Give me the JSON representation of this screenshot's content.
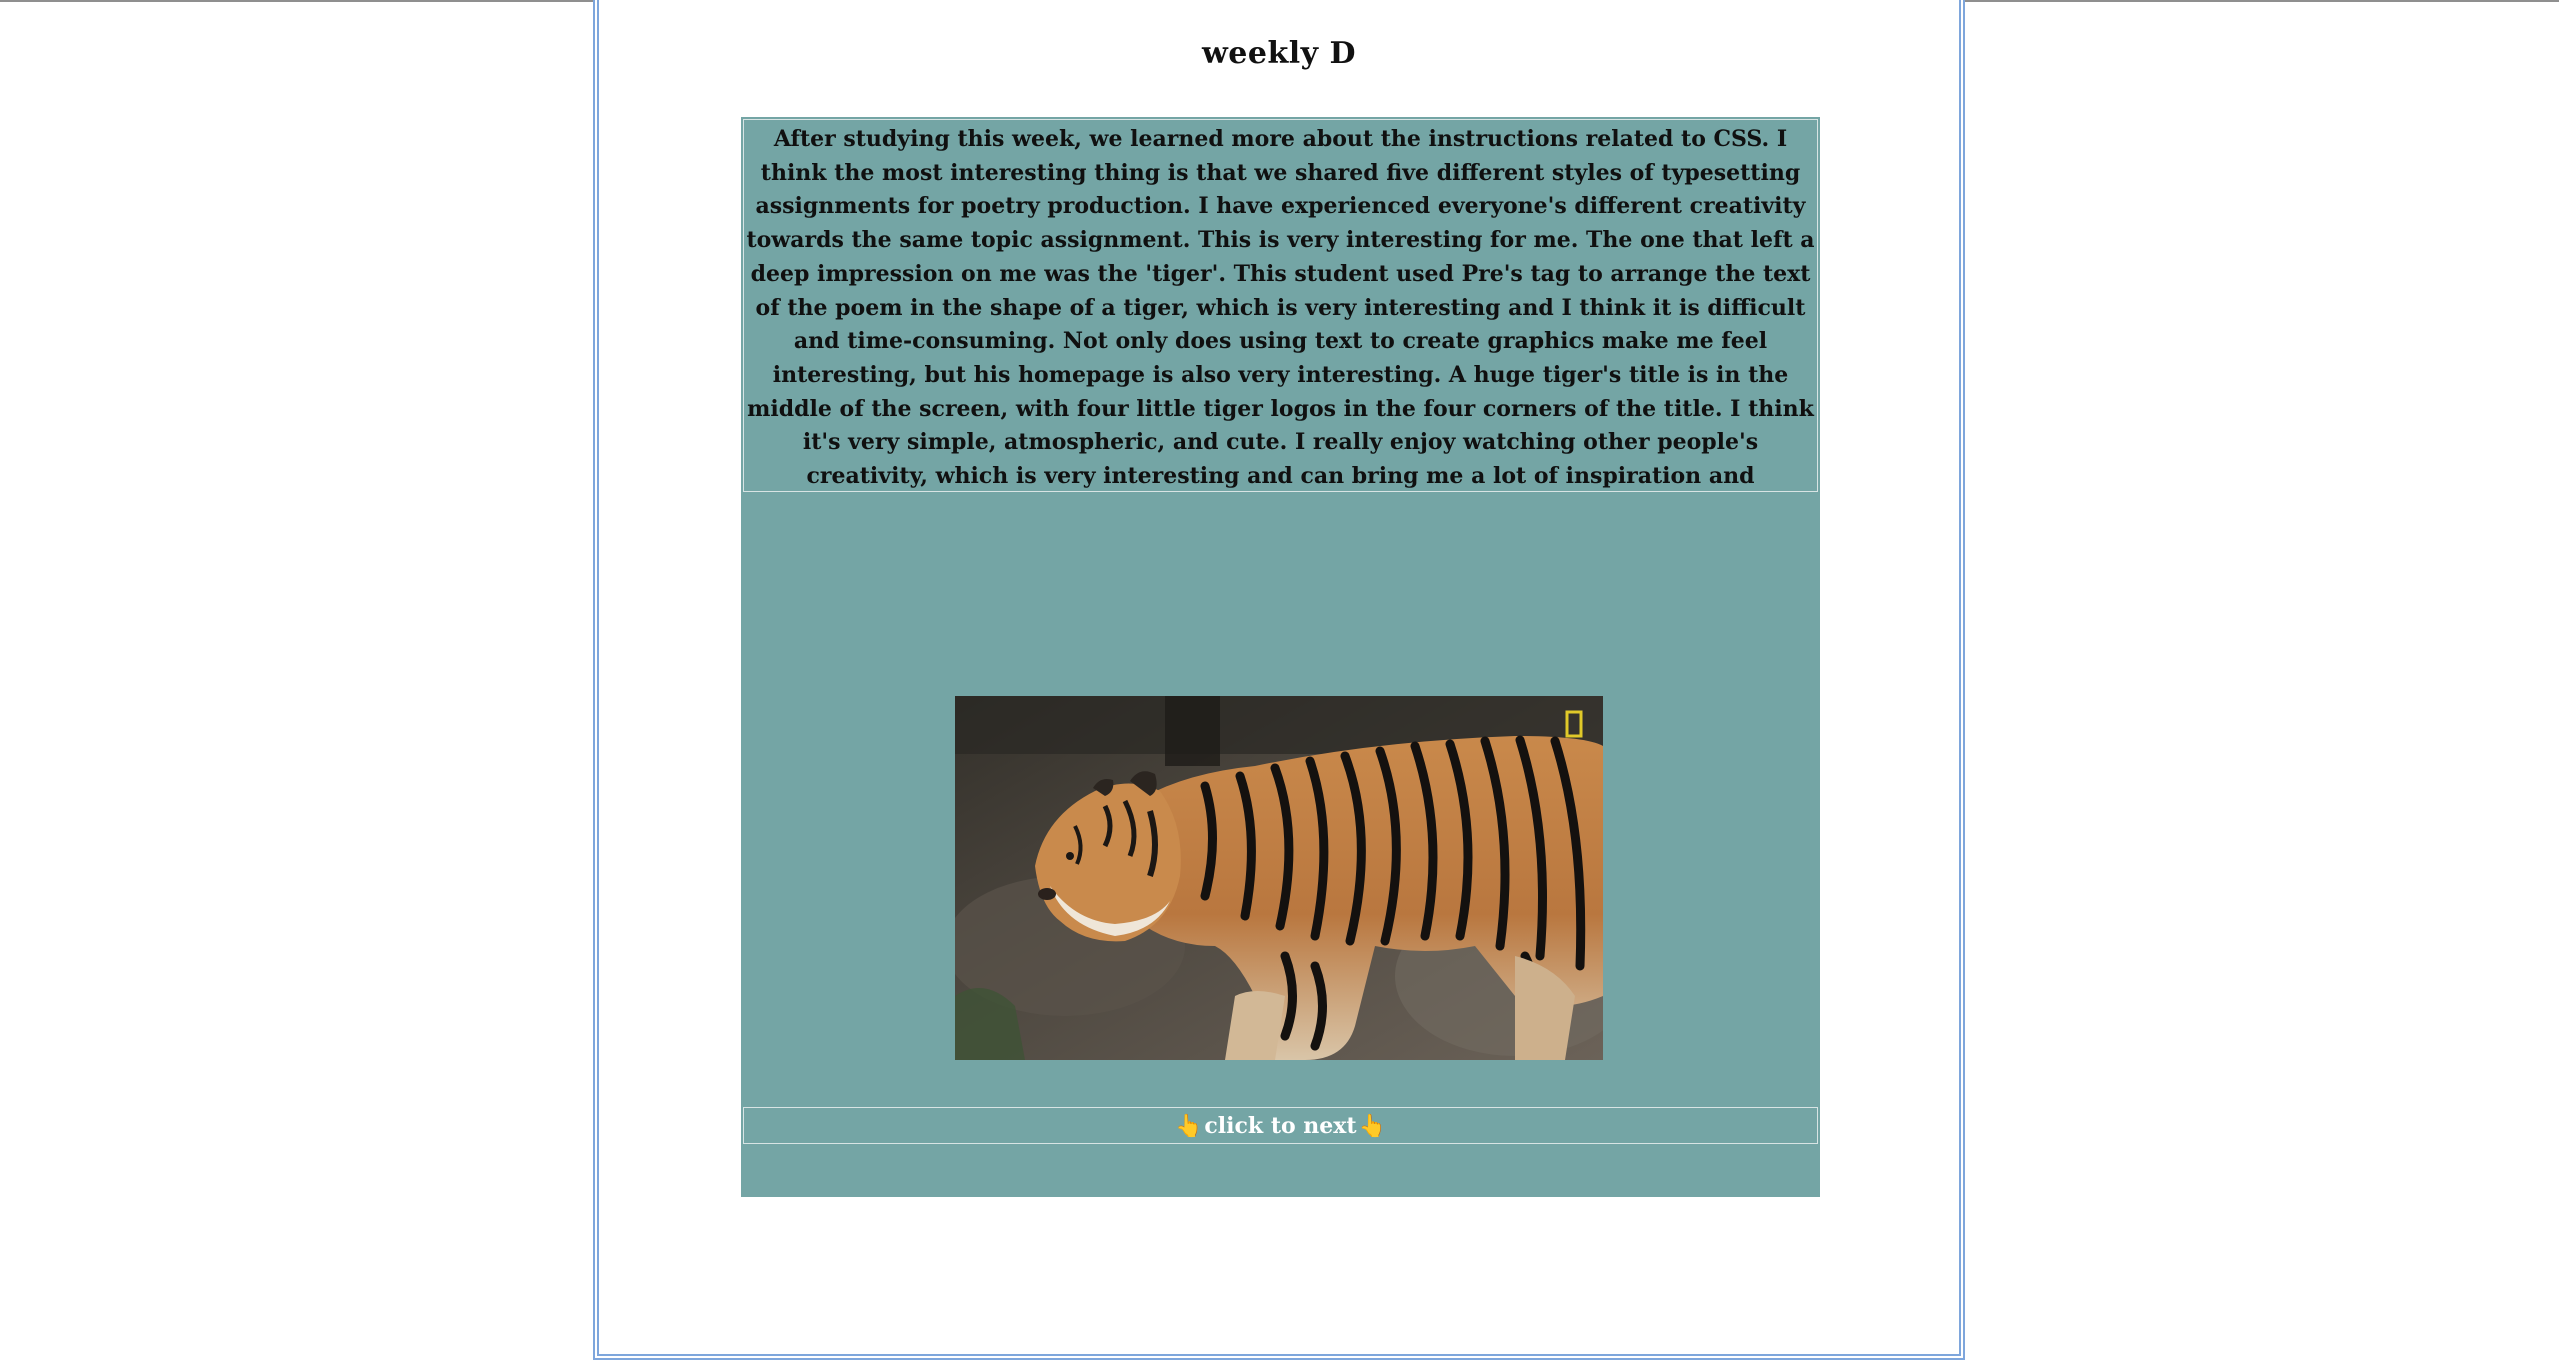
{
  "page": {
    "title": "weekly D"
  },
  "essay": {
    "text": "After studying this week, we learned more about the instructions related to CSS. I think the most interesting thing is that we shared five different styles of typesetting assignments for poetry production. I have experienced everyone's different creativity towards the same topic assignment. This is very interesting for me. The one that left a deep impression on me was the 'tiger'. This student used Pre's tag to arrange the text of the poem in the shape of a tiger, which is very interesting and I think it is difficult and time-consuming. Not only does using text to create graphics make me feel interesting, but his homepage is also very interesting. A huge tiger's title is in the middle of the screen, with four little tiger logos in the four corners of the title. I think it's very simple, atmospheric, and cute. I really enjoy watching other people's creativity, which is very interesting and can bring me a lot of inspiration and inspiration. Looking forward to future assignments."
  },
  "media": {
    "image_subject": "walking-tiger-photo",
    "watermark_icon": "yellow-rectangle-logo-icon"
  },
  "navigation": {
    "next_label": "click to next",
    "hand_icon": "pointing-hand-icon",
    "hand_glyph": "👆"
  },
  "colors": {
    "panel": "#74a5a5",
    "frame": "#7ea6dc",
    "next_text": "#ffffff"
  }
}
